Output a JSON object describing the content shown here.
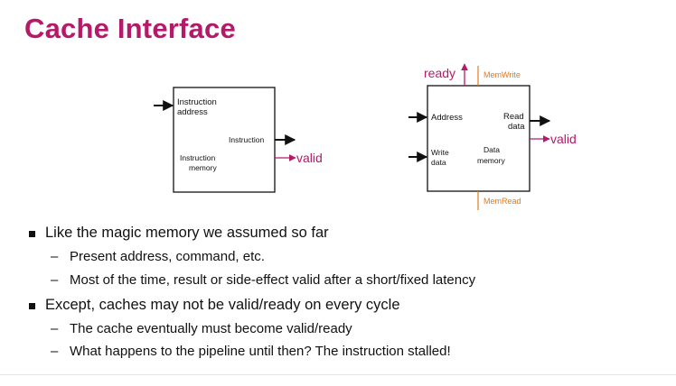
{
  "title": "Cache Interface",
  "imem": {
    "input_label_1": "Instruction",
    "input_label_2": "address",
    "output_label": "Instruction",
    "name_1": "Instruction",
    "name_2": "memory",
    "valid_label": "valid"
  },
  "dmem": {
    "ready_label": "ready",
    "memwrite_label": "MemWrite",
    "memread_label": "MemRead",
    "address_label": "Address",
    "writedata_1": "Write",
    "writedata_2": "data",
    "readdata_1": "Read",
    "readdata_2": "data",
    "name_1": "Data",
    "name_2": "memory",
    "valid_label": "valid"
  },
  "colors": {
    "accent": "#b5196a",
    "control": "#e07a1e",
    "ink": "#111111"
  },
  "bullets": [
    {
      "text": "Like the magic memory we assumed so far",
      "subs": [
        "Present address, command, etc.",
        "Most of the time, result or side-effect valid after a short/fixed latency"
      ]
    },
    {
      "text": "Except, caches may not be valid/ready on every cycle",
      "subs": [
        "The cache eventually must become valid/ready",
        "What happens to the pipeline until then? The instruction stalled!"
      ]
    }
  ],
  "dash_glyph": "–"
}
